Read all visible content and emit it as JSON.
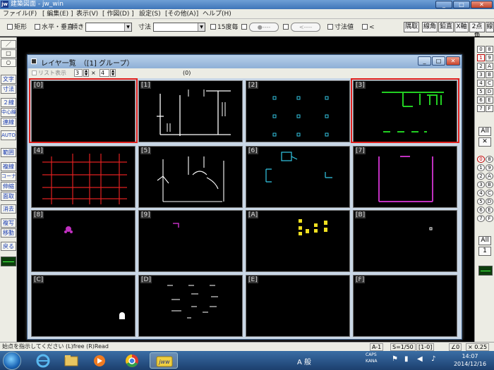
{
  "app": {
    "title": "建築図面 - jw_win",
    "icon_text": "jw",
    "window_buttons": [
      "_",
      "□",
      "✕"
    ]
  },
  "menu": [
    "ファイル(F)",
    "[ 編集(E) ]",
    "表示(V)",
    "[ 作図(D) ]",
    "設定(S)",
    "[その他(A)]",
    "ヘルプ(H)"
  ],
  "toolbar": {
    "rect_label": "矩形",
    "horiz_label": "水平・垂直",
    "slope_label": "傾き",
    "size_label": "寸法",
    "angle15_label": "15度毎",
    "pill1": "●----",
    "pill2": "<----",
    "dimval_label": "寸法値",
    "lt_label": "<",
    "right_buttons": [
      "隅取",
      "線角",
      "鉛直",
      "X軸",
      "2点角",
      "線"
    ]
  },
  "left_palette": [
    "／",
    "□",
    "○",
    "文字",
    "寸法",
    "２線",
    "中心線",
    "連線",
    "AUTO",
    "範囲",
    "複線",
    "コーナー",
    "伸縮",
    "面取",
    "消去",
    "複写",
    "移動",
    "戻る"
  ],
  "right_palette": {
    "pairs": [
      [
        "0",
        "8"
      ],
      [
        "1",
        "9"
      ],
      [
        "2",
        "A"
      ],
      [
        "3",
        "B"
      ],
      [
        "4",
        "C"
      ],
      [
        "5",
        "D"
      ],
      [
        "6",
        "E"
      ],
      [
        "7",
        "F"
      ]
    ],
    "all_label": "All",
    "x_label": "✕",
    "circle_pairs": [
      [
        "0",
        "8"
      ],
      [
        "1",
        "9"
      ],
      [
        "2",
        "A"
      ],
      [
        "3",
        "B"
      ],
      [
        "4",
        "C"
      ],
      [
        "5",
        "D"
      ],
      [
        "6",
        "E"
      ],
      [
        "7",
        "F"
      ]
    ],
    "all2_label": "All",
    "num_label": "1"
  },
  "status": {
    "message": "始点を指示してください (L)free (R)Read",
    "paper": "A-1",
    "scale": "S=1/50",
    "layer": "[1-0]",
    "angle": "∠0",
    "zoom": "× 0.25"
  },
  "taskbar": {
    "time": "14:07",
    "date": "2014/12/16",
    "ime_text": "A 般",
    "caps_text": "CAPS",
    "kana_text": "KANA"
  },
  "dialog": {
    "title": "レイヤ一覧　（[1] グループ）",
    "list_display_label": "リスト表示",
    "spin1": "3",
    "times": "×",
    "spin2": "4",
    "group_indicator": "(0)",
    "layers": [
      {
        "label": "[0]",
        "highlight": true
      },
      {
        "label": "[1]",
        "highlight": false
      },
      {
        "label": "[2]",
        "highlight": false
      },
      {
        "label": "[3]",
        "highlight": true
      },
      {
        "label": "[4]",
        "highlight": false
      },
      {
        "label": "[5]",
        "highlight": false
      },
      {
        "label": "[6]",
        "highlight": false
      },
      {
        "label": "[7]",
        "highlight": false
      },
      {
        "label": "[8]",
        "highlight": false
      },
      {
        "label": "[9]",
        "highlight": false
      },
      {
        "label": "[A]",
        "highlight": false
      },
      {
        "label": "[B]",
        "highlight": false
      },
      {
        "label": "[C]",
        "highlight": false
      },
      {
        "label": "[D]",
        "highlight": false
      },
      {
        "label": "[E]",
        "highlight": false
      },
      {
        "label": "[F]",
        "highlight": false
      }
    ],
    "preview_colors": {
      "white": "#ffffff",
      "cyan": "#33c8e6",
      "green": "#22d022",
      "red": "#e02020",
      "magenta": "#c030c0",
      "yellow": "#f0e020"
    },
    "highlight_color": "#e0201c"
  }
}
